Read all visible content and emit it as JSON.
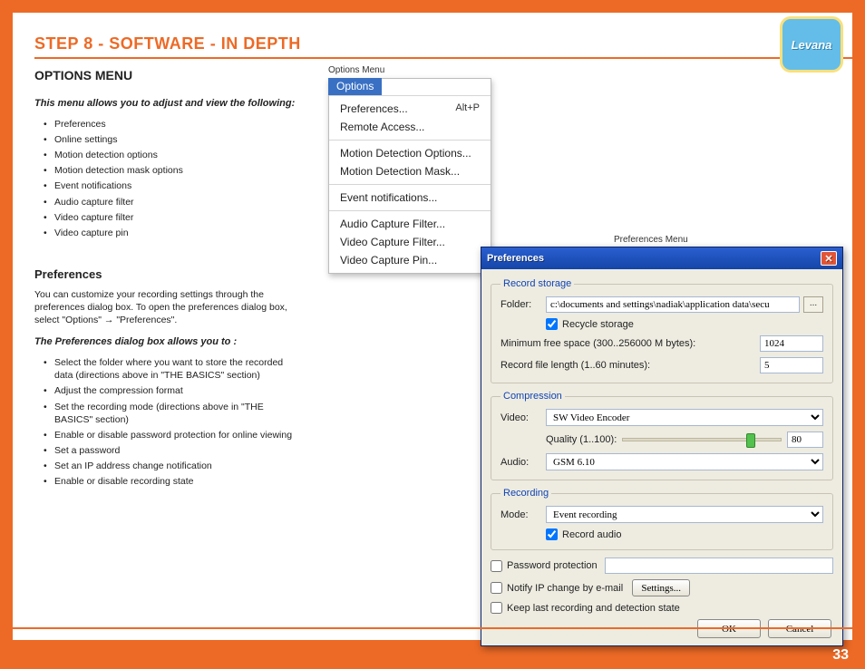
{
  "header": {
    "title": "STEP 8   - SOFTWARE - IN DEPTH"
  },
  "logo": {
    "text": "Levana"
  },
  "page_number": "33",
  "left": {
    "h_options": "OPTIONS MENU",
    "intro": "This menu allows you to adjust and view the following:",
    "menu_list": [
      "Preferences",
      "Online settings",
      "Motion detection options",
      "Motion detection mask options",
      "Event notifications",
      "Audio capture filter",
      "Video capture filter",
      "Video capture pin"
    ],
    "h_prefs": "Preferences",
    "prefs_body": "You can customize your recording settings through the preferences dialog box. To open the preferences dialog box, select \"Options\" → \"Preferences\".",
    "prefs_intro": "The Preferences dialog box allows you to :",
    "prefs_list": [
      "Select the folder where you want to store the recorded data (directions above in \"THE BASICS\" section)",
      "Adjust the compression format",
      "Set the recording mode (directions above in \"THE BASICS\" section)",
      "Enable or disable password protection for online viewing",
      "Set a password",
      "Set an IP address change notification",
      "Enable or disable recording state"
    ]
  },
  "labels": {
    "options_menu_caption": "Options Menu",
    "prefs_menu_caption": "Preferences Menu"
  },
  "options_menu": {
    "tab": "Options",
    "g1": [
      {
        "label": "Preferences...",
        "shortcut": "Alt+P"
      },
      {
        "label": "Remote Access..."
      }
    ],
    "g2": [
      {
        "label": "Motion Detection Options..."
      },
      {
        "label": "Motion Detection Mask..."
      }
    ],
    "g3": [
      {
        "label": "Event notifications..."
      }
    ],
    "g4": [
      {
        "label": "Audio Capture Filter..."
      },
      {
        "label": "Video Capture Filter..."
      },
      {
        "label": "Video Capture Pin..."
      }
    ]
  },
  "prefs": {
    "title": "Preferences",
    "storage": {
      "legend": "Record storage",
      "folder_label": "Folder:",
      "folder_value": "c:\\documents and settings\\nadiak\\application data\\secu",
      "browse": "...",
      "recycle": "Recycle storage",
      "minfree_label": "Minimum free space (300..256000 M bytes):",
      "minfree_value": "1024",
      "reclen_label": "Record file length (1..60 minutes):",
      "reclen_value": "5"
    },
    "compression": {
      "legend": "Compression",
      "video_label": "Video:",
      "video_value": "SW Video Encoder",
      "quality_label": "Quality (1..100):",
      "quality_value": "80",
      "audio_label": "Audio:",
      "audio_value": "GSM 6.10"
    },
    "recording": {
      "legend": "Recording",
      "mode_label": "Mode:",
      "mode_value": "Event recording",
      "rec_audio": "Record audio"
    },
    "pwd": "Password protection",
    "notify_ip": "Notify IP change by e-mail",
    "settings_btn": "Settings...",
    "keep_last": "Keep last recording and detection state",
    "ok": "OK",
    "cancel": "Cancel"
  }
}
